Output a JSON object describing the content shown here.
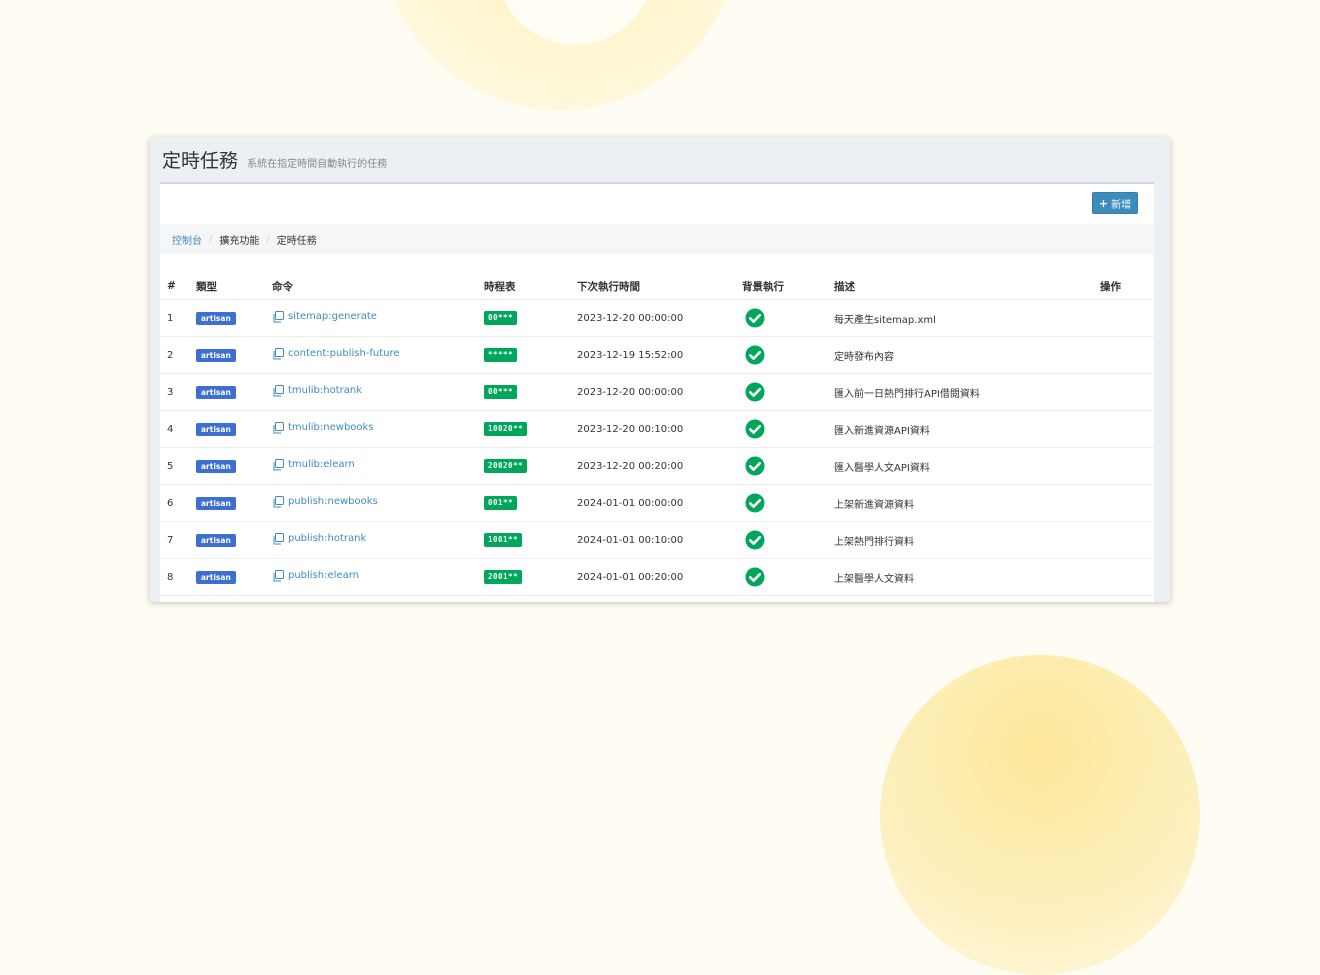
{
  "page": {
    "title": "定時任務",
    "subtitle": "系統在指定時間自動執行的任務"
  },
  "toolbar": {
    "add_label": "新增",
    "add_icon": "plus-icon"
  },
  "breadcrumb": [
    {
      "label": "控制台"
    },
    {
      "label": "擴充功能"
    },
    {
      "label": "定時任務"
    }
  ],
  "table": {
    "columns": {
      "num": "#",
      "type": "類型",
      "command": "命令",
      "schedule": "時程表",
      "next_run": "下次執行時間",
      "background": "背景執行",
      "description": "描述",
      "actions": "操作"
    },
    "rows": [
      {
        "num": "1",
        "type": "artisan",
        "command": "sitemap:generate",
        "schedule": "00***",
        "next_run": "2023-12-20 00:00:00",
        "background": true,
        "description": "每天產生sitemap.xml"
      },
      {
        "num": "2",
        "type": "artisan",
        "command": "content:publish-future",
        "schedule": "*****",
        "next_run": "2023-12-19 15:52:00",
        "background": true,
        "description": "定時發布內容"
      },
      {
        "num": "3",
        "type": "artisan",
        "command": "tmulib:hotrank",
        "schedule": "00***",
        "next_run": "2023-12-20 00:00:00",
        "background": true,
        "description": "匯入前一日熱門排行API借閱資料"
      },
      {
        "num": "4",
        "type": "artisan",
        "command": "tmulib:newbooks",
        "schedule": "10020**",
        "next_run": "2023-12-20 00:10:00",
        "background": true,
        "description": "匯入新進資源API資料"
      },
      {
        "num": "5",
        "type": "artisan",
        "command": "tmulib:elearn",
        "schedule": "20020**",
        "next_run": "2023-12-20 00:20:00",
        "background": true,
        "description": "匯入醫學人文API資料"
      },
      {
        "num": "6",
        "type": "artisan",
        "command": "publish:newbooks",
        "schedule": "001**",
        "next_run": "2024-01-01 00:00:00",
        "background": true,
        "description": "上架新進資源資料"
      },
      {
        "num": "7",
        "type": "artisan",
        "command": "publish:hotrank",
        "schedule": "1001**",
        "next_run": "2024-01-01 00:10:00",
        "background": true,
        "description": "上架熱門排行資料"
      },
      {
        "num": "8",
        "type": "artisan",
        "command": "publish:elearn",
        "schedule": "2001**",
        "next_run": "2024-01-01 00:20:00",
        "background": true,
        "description": "上架醫學人文資料"
      }
    ]
  },
  "colors": {
    "accent": "#3c8dbc",
    "artisan_badge": "#3d6ed1",
    "schedule_badge": "#00a65a",
    "check": "#00a65a"
  },
  "icons": {
    "copy": "copy-icon",
    "background_check": "check-circle-icon"
  }
}
